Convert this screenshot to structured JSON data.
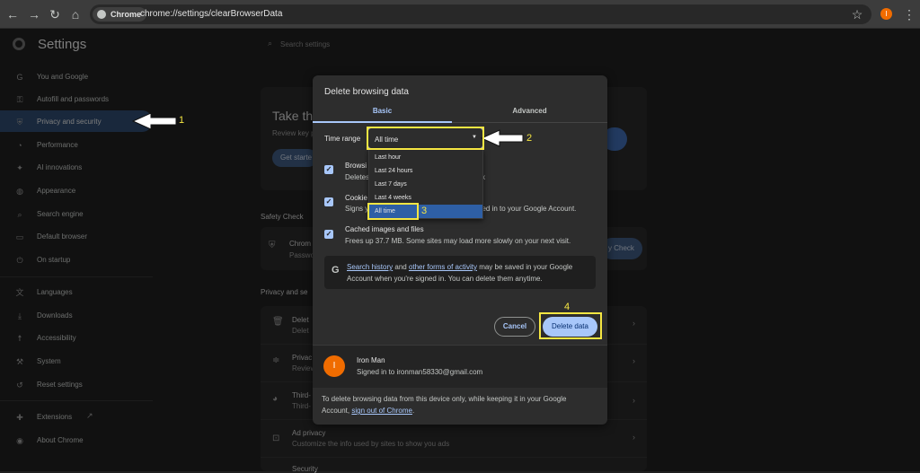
{
  "browser": {
    "chip_label": "Chrome",
    "url": "chrome://settings/clearBrowserData",
    "profile_initial": "I"
  },
  "settings": {
    "title": "Settings",
    "search_placeholder": "Search settings",
    "nav": [
      {
        "label": "You and Google",
        "icon": "google-icon"
      },
      {
        "label": "Autofill and passwords",
        "icon": "key-icon"
      },
      {
        "label": "Privacy and security",
        "icon": "shield-icon"
      },
      {
        "label": "Performance",
        "icon": "speedometer-icon"
      },
      {
        "label": "AI innovations",
        "icon": "sparkle-icon"
      },
      {
        "label": "Appearance",
        "icon": "palette-icon"
      },
      {
        "label": "Search engine",
        "icon": "search-icon"
      },
      {
        "label": "Default browser",
        "icon": "browser-icon"
      },
      {
        "label": "On startup",
        "icon": "power-icon"
      },
      {
        "label": "Languages",
        "icon": "translate-icon"
      },
      {
        "label": "Downloads",
        "icon": "download-icon"
      },
      {
        "label": "Accessibility",
        "icon": "accessibility-icon"
      },
      {
        "label": "System",
        "icon": "wrench-icon"
      },
      {
        "label": "Reset settings",
        "icon": "reset-icon"
      },
      {
        "label": "Extensions",
        "icon": "puzzle-icon"
      },
      {
        "label": "About Chrome",
        "icon": "chrome-icon"
      }
    ]
  },
  "background": {
    "take_title": "Take the",
    "review_key": "Review key p",
    "get_started": "Get starte",
    "safety_check": "Safety Check",
    "chrome_label": "Chrom",
    "password_label": "Passwo",
    "check_button": "y Check",
    "privacy_heading": "Privacy and se",
    "rows": [
      {
        "title": "Delet",
        "desc": "Delet"
      },
      {
        "title": "Privac",
        "desc": "Review"
      },
      {
        "title": "Third-",
        "desc": "Third-"
      },
      {
        "title": "Ad privacy",
        "desc": "Customize the info used by sites to show you ads"
      },
      {
        "title": "Security",
        "desc": ""
      }
    ]
  },
  "dialog": {
    "title": "Delete browsing data",
    "tabs": [
      "Basic",
      "Advanced"
    ],
    "time_range_label": "Time range",
    "time_range_value": "All time",
    "options": [
      {
        "title": "Browsi",
        "desc": "Deletes",
        "desc_tail": "x"
      },
      {
        "title": "Cookie",
        "desc": "Signs y",
        "desc_tail": "ned in to your Google Account."
      },
      {
        "title": "Cached images and files",
        "desc": "Frees up 37.7 MB. Some sites may load more slowly on your next visit."
      }
    ],
    "info": {
      "link1": "Search history",
      "and": " and ",
      "link2": "other forms of activity",
      "line1_tail": " may be saved in your Google",
      "line2": "Account when you're signed in. You can delete them anytime."
    },
    "cancel_label": "Cancel",
    "delete_label": "Delete data",
    "account": {
      "initial": "I",
      "name": "Iron Man",
      "email": "Signed in to ironman58330@gmail.com"
    },
    "footer_line1": "To delete browsing data from this device only, while keeping it in your Google",
    "footer_prefix": "Account, ",
    "footer_link": "sign out of Chrome",
    "footer_suffix": "."
  },
  "dropdown": {
    "options": [
      "Last hour",
      "Last 24 hours",
      "Last 7 days",
      "Last 4 weeks",
      "All time"
    ],
    "selected": "All time"
  },
  "annotations": {
    "step1": "1",
    "step2": "2",
    "step3": "3",
    "step4": "4",
    "color": "#f5e642"
  }
}
